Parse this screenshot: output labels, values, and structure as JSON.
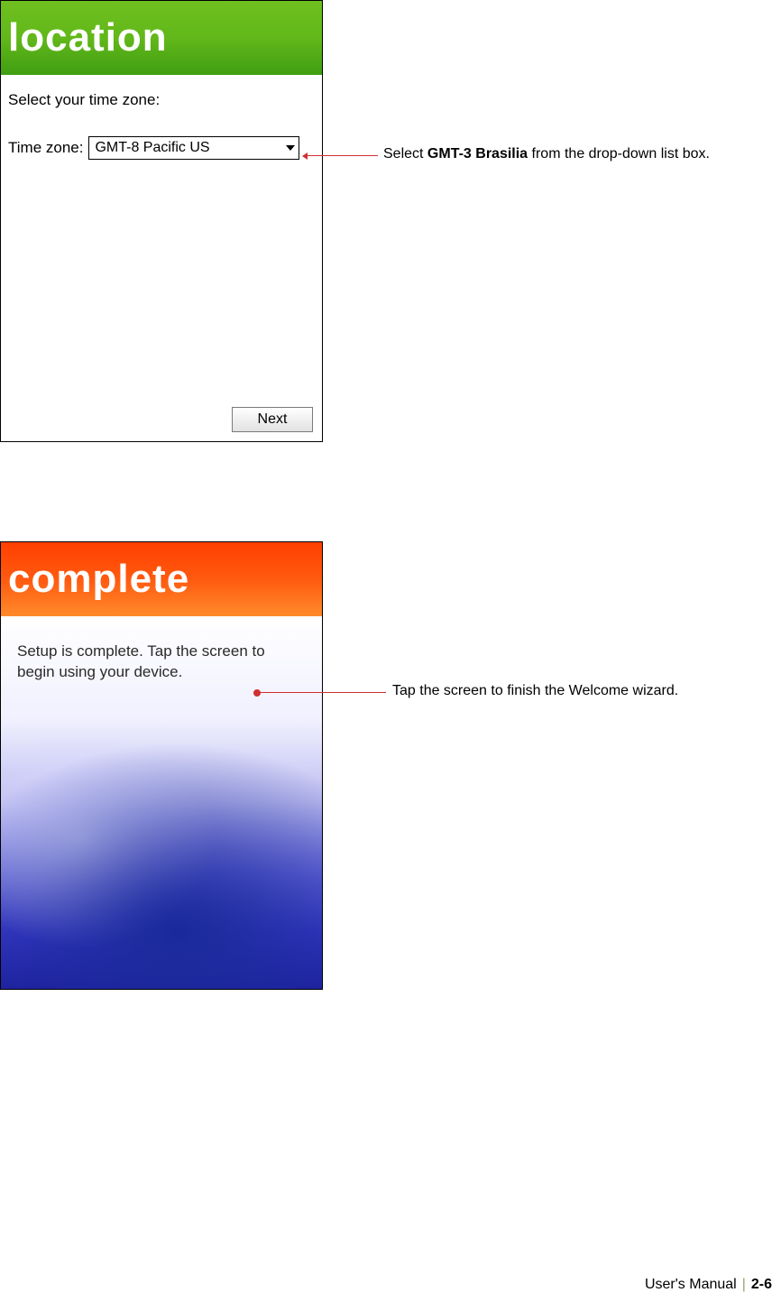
{
  "screen1": {
    "header_title": "location",
    "prompt": "Select your time zone:",
    "tz_label": "Time zone:",
    "tz_value": "GMT-8 Pacific US",
    "next_label": "Next"
  },
  "screen2": {
    "header_title": "complete",
    "body_text": "Setup is complete. Tap the screen to begin using your device."
  },
  "callouts": {
    "c1_pre": "Select ",
    "c1_bold": "GMT-3 Brasilia",
    "c1_post": " from the drop-down list box.",
    "c2": "Tap the screen to finish the Welcome wizard."
  },
  "footer": {
    "manual": "User's Manual",
    "page": "2-6"
  }
}
